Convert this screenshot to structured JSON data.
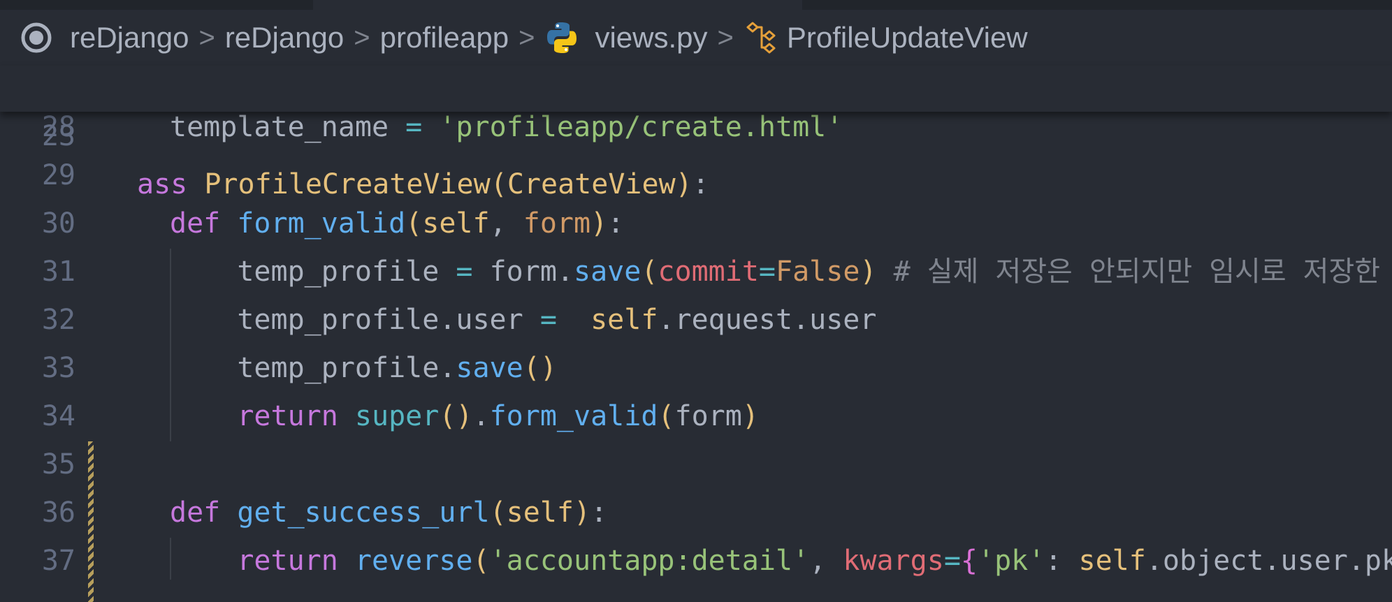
{
  "breadcrumb": {
    "items": [
      "reDjango",
      "reDjango",
      "profileapp",
      "views.py",
      "ProfileUpdateView"
    ],
    "separator": ">"
  },
  "editor": {
    "sticky_scroll": {
      "number": "23",
      "tokens": [
        {
          "t": "ass ",
          "c": "kw"
        },
        {
          "t": "ProfileCreateView",
          "c": "cls"
        },
        {
          "t": "(",
          "c": "par"
        },
        {
          "t": "CreateView",
          "c": "cls"
        },
        {
          "t": ")",
          "c": "par"
        },
        {
          "t": ":",
          "c": ""
        }
      ]
    },
    "lines": [
      {
        "number": "28",
        "tokens": [
          {
            "t": "template_name ",
            "c": ""
          },
          {
            "t": "=",
            "c": "op"
          },
          {
            "t": " ",
            "c": ""
          },
          {
            "t": "'profileapp/create.html'",
            "c": "str"
          }
        ]
      },
      {
        "number": "29",
        "tokens": []
      },
      {
        "number": "30",
        "tokens": [
          {
            "t": "def ",
            "c": "kw"
          },
          {
            "t": "form_valid",
            "c": "fn"
          },
          {
            "t": "(",
            "c": "par"
          },
          {
            "t": "self",
            "c": "self"
          },
          {
            "t": ", ",
            "c": ""
          },
          {
            "t": "form",
            "c": "const"
          },
          {
            "t": ")",
            "c": "par"
          },
          {
            "t": ":",
            "c": ""
          }
        ]
      },
      {
        "number": "31",
        "tokens": [
          {
            "t": "    temp_profile ",
            "c": ""
          },
          {
            "t": "=",
            "c": "op"
          },
          {
            "t": " form.",
            "c": ""
          },
          {
            "t": "save",
            "c": "fn"
          },
          {
            "t": "(",
            "c": "par"
          },
          {
            "t": "commit",
            "c": "kwarg"
          },
          {
            "t": "=",
            "c": "op"
          },
          {
            "t": "False",
            "c": "const"
          },
          {
            "t": ")",
            "c": "par"
          },
          {
            "t": " # 실제 저장은 안되지만 임시로 저장한",
            "c": "cmt"
          }
        ]
      },
      {
        "number": "32",
        "tokens": [
          {
            "t": "    temp_profile.user ",
            "c": ""
          },
          {
            "t": "=",
            "c": "op"
          },
          {
            "t": "  ",
            "c": ""
          },
          {
            "t": "self",
            "c": "self"
          },
          {
            "t": ".request.user",
            "c": ""
          }
        ]
      },
      {
        "number": "33",
        "tokens": [
          {
            "t": "    temp_profile.",
            "c": ""
          },
          {
            "t": "save",
            "c": "fn"
          },
          {
            "t": "()",
            "c": "par"
          }
        ]
      },
      {
        "number": "34",
        "tokens": [
          {
            "t": "    ",
            "c": ""
          },
          {
            "t": "return ",
            "c": "kw"
          },
          {
            "t": "super",
            "c": "bi"
          },
          {
            "t": "()",
            "c": "par"
          },
          {
            "t": ".",
            "c": ""
          },
          {
            "t": "form_valid",
            "c": "fn"
          },
          {
            "t": "(",
            "c": "par"
          },
          {
            "t": "form",
            "c": ""
          },
          {
            "t": ")",
            "c": "par"
          }
        ]
      },
      {
        "number": "35",
        "tokens": []
      },
      {
        "number": "36",
        "tokens": [
          {
            "t": "def ",
            "c": "kw"
          },
          {
            "t": "get_success_url",
            "c": "fn"
          },
          {
            "t": "(",
            "c": "par"
          },
          {
            "t": "self",
            "c": "self"
          },
          {
            "t": ")",
            "c": "par"
          },
          {
            "t": ":",
            "c": ""
          }
        ]
      },
      {
        "number": "37",
        "tokens": [
          {
            "t": "    ",
            "c": ""
          },
          {
            "t": "return ",
            "c": "kw"
          },
          {
            "t": "reverse",
            "c": "fn"
          },
          {
            "t": "(",
            "c": "par"
          },
          {
            "t": "'accountapp:detail'",
            "c": "str"
          },
          {
            "t": ", ",
            "c": ""
          },
          {
            "t": "kwargs",
            "c": "kwarg"
          },
          {
            "t": "=",
            "c": "op"
          },
          {
            "t": "{",
            "c": "brace"
          },
          {
            "t": "'pk'",
            "c": "str"
          },
          {
            "t": ": ",
            "c": ""
          },
          {
            "t": "self",
            "c": "self"
          },
          {
            "t": ".object.user.pk",
            "c": ""
          },
          {
            "t": "}",
            "c": "brace"
          },
          {
            "t": ")",
            "c": "par"
          }
        ]
      }
    ]
  },
  "colors": {
    "background": "#282c34",
    "keyword": "#c678dd",
    "class": "#e5c07b",
    "function": "#61afef",
    "string": "#98c379",
    "comment": "#7f848e",
    "line_number": "#636d83"
  }
}
